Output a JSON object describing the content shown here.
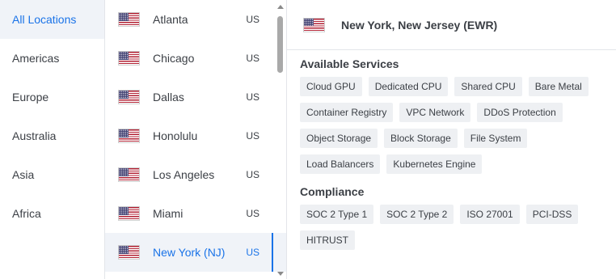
{
  "regions": [
    {
      "label": "All Locations",
      "active": true
    },
    {
      "label": "Americas",
      "active": false
    },
    {
      "label": "Europe",
      "active": false
    },
    {
      "label": "Australia",
      "active": false
    },
    {
      "label": "Asia",
      "active": false
    },
    {
      "label": "Africa",
      "active": false
    }
  ],
  "cities": [
    {
      "name": "Atlanta",
      "country": "US",
      "flag": "us-flag-icon",
      "active": false
    },
    {
      "name": "Chicago",
      "country": "US",
      "flag": "us-flag-icon",
      "active": false
    },
    {
      "name": "Dallas",
      "country": "US",
      "flag": "us-flag-icon",
      "active": false
    },
    {
      "name": "Honolulu",
      "country": "US",
      "flag": "us-flag-icon",
      "active": false
    },
    {
      "name": "Los Angeles",
      "country": "US",
      "flag": "us-flag-icon",
      "active": false
    },
    {
      "name": "Miami",
      "country": "US",
      "flag": "us-flag-icon",
      "active": false
    },
    {
      "name": "New York (NJ)",
      "country": "US",
      "flag": "us-flag-icon",
      "active": true
    }
  ],
  "detail": {
    "title": "New York, New Jersey (EWR)",
    "flag": "us-flag-icon",
    "services_heading": "Available Services",
    "services": [
      "Cloud GPU",
      "Dedicated CPU",
      "Shared CPU",
      "Bare Metal",
      "Container Registry",
      "VPC Network",
      "DDoS Protection",
      "Object Storage",
      "Block Storage",
      "File System",
      "Load Balancers",
      "Kubernetes Engine"
    ],
    "compliance_heading": "Compliance",
    "compliance": [
      "SOC 2 Type 1",
      "SOC 2 Type 2",
      "ISO 27001",
      "PCI-DSS",
      "HITRUST"
    ]
  },
  "colors": {
    "accent": "#1a73e8",
    "selected_bg": "#f0f3f8",
    "tag_bg": "#eef0f3"
  }
}
